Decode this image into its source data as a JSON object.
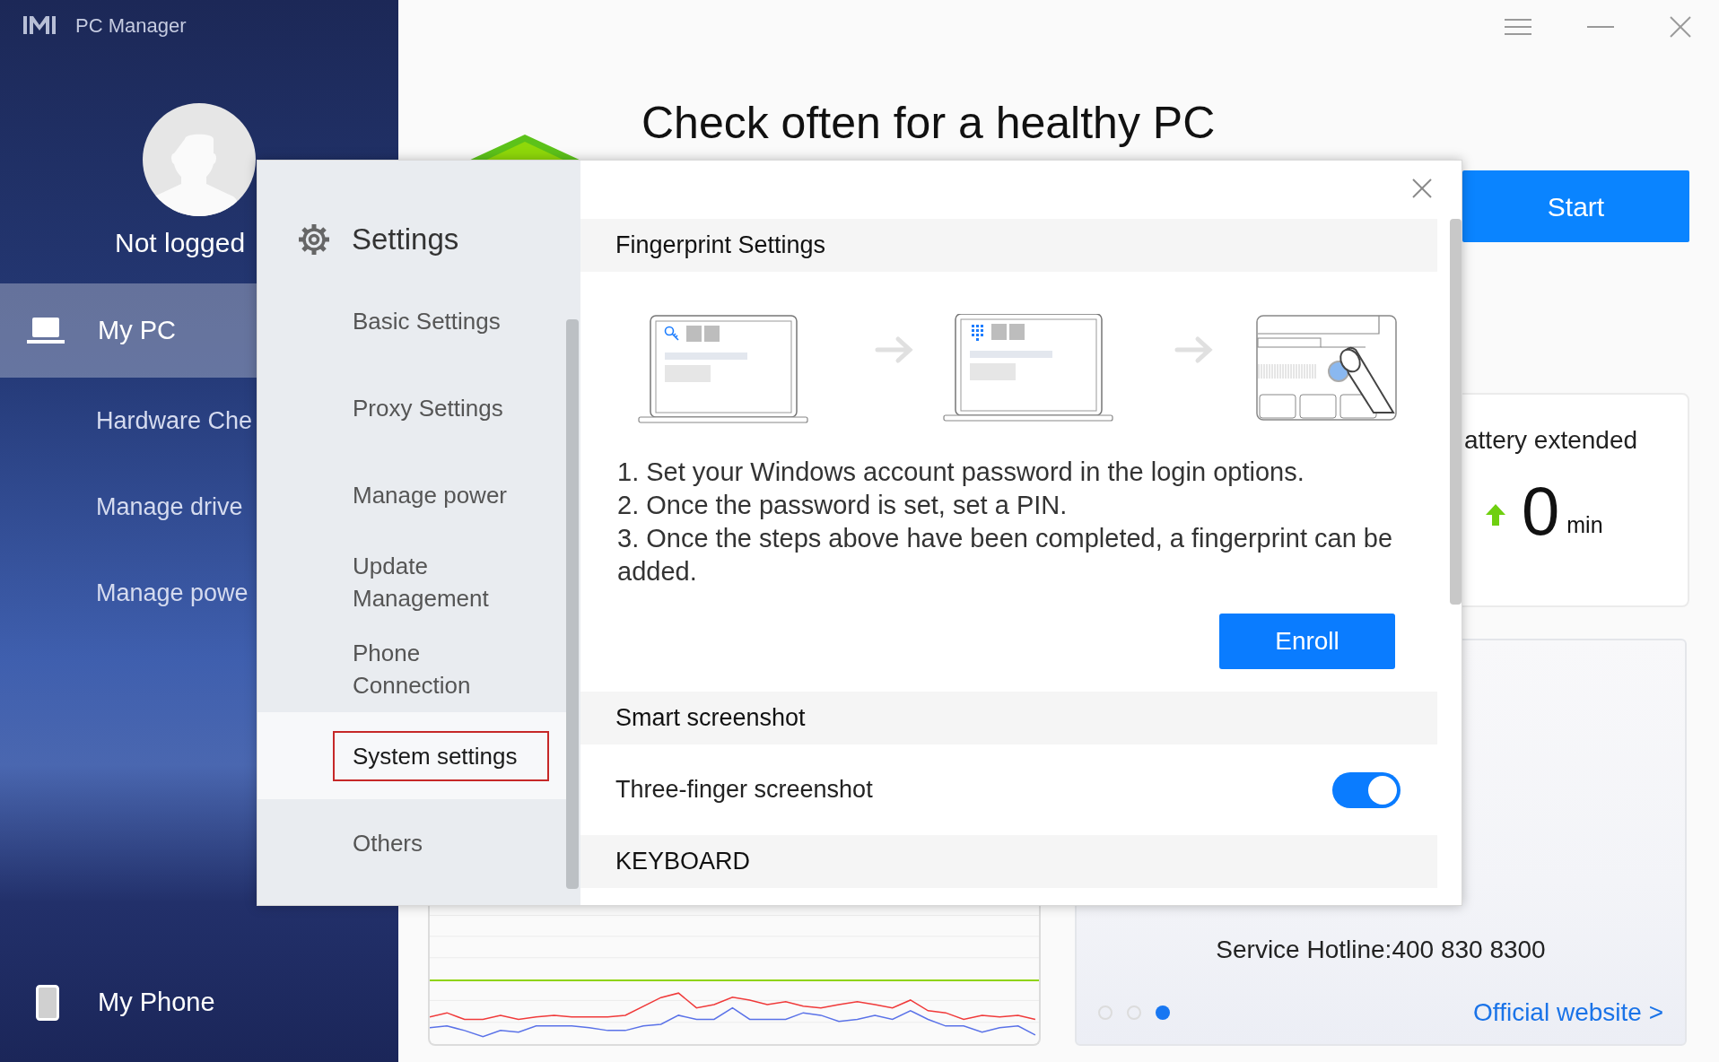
{
  "app": {
    "title": "PC Manager"
  },
  "account": {
    "status": "Not logged"
  },
  "sidebar": {
    "main_item": {
      "label": "My PC",
      "selected": true
    },
    "sub_items": [
      {
        "label": "Hardware Che",
        "selected": false
      },
      {
        "label": "Manage drive",
        "selected": false
      },
      {
        "label": "Manage powe",
        "selected": false
      }
    ],
    "bottom_item": {
      "label": "My Phone",
      "selected": false
    }
  },
  "home": {
    "heading": "Check often for a healthy PC",
    "start_button": "Start",
    "battery_card": {
      "title": "attery extended",
      "value": "0",
      "unit": "min"
    },
    "service_card": {
      "hotline": "Service Hotline:400 830 8300",
      "link": "Official website >",
      "pages": [
        {
          "selected": false
        },
        {
          "selected": false
        },
        {
          "selected": true
        }
      ]
    }
  },
  "settings_dialog": {
    "title": "Settings",
    "nav": [
      {
        "label": "Basic Settings",
        "selected": false,
        "highlighted": false
      },
      {
        "label": "Proxy Settings",
        "selected": false,
        "highlighted": false
      },
      {
        "label": "Manage power",
        "selected": false,
        "highlighted": false
      },
      {
        "label": "Update Management",
        "selected": false,
        "highlighted": false
      },
      {
        "label": "Phone Connection",
        "selected": false,
        "highlighted": false
      },
      {
        "label": "System settings",
        "selected": true,
        "highlighted": true
      },
      {
        "label": "Others",
        "selected": false,
        "highlighted": false
      }
    ],
    "sections": [
      {
        "kind": "fingerprint",
        "title": "Fingerprint Settings",
        "steps": [
          "1. Set your Windows account password in the login options.",
          "2. Once the password is set, set a PIN.",
          "3. Once the steps above have been completed, a fingerprint can be added."
        ],
        "button": "Enroll"
      },
      {
        "kind": "toggles",
        "title": "Smart screenshot",
        "rows": [
          {
            "label": "Three-finger screenshot",
            "on": true
          }
        ]
      },
      {
        "kind": "header",
        "title": "KEYBOARD"
      }
    ]
  }
}
